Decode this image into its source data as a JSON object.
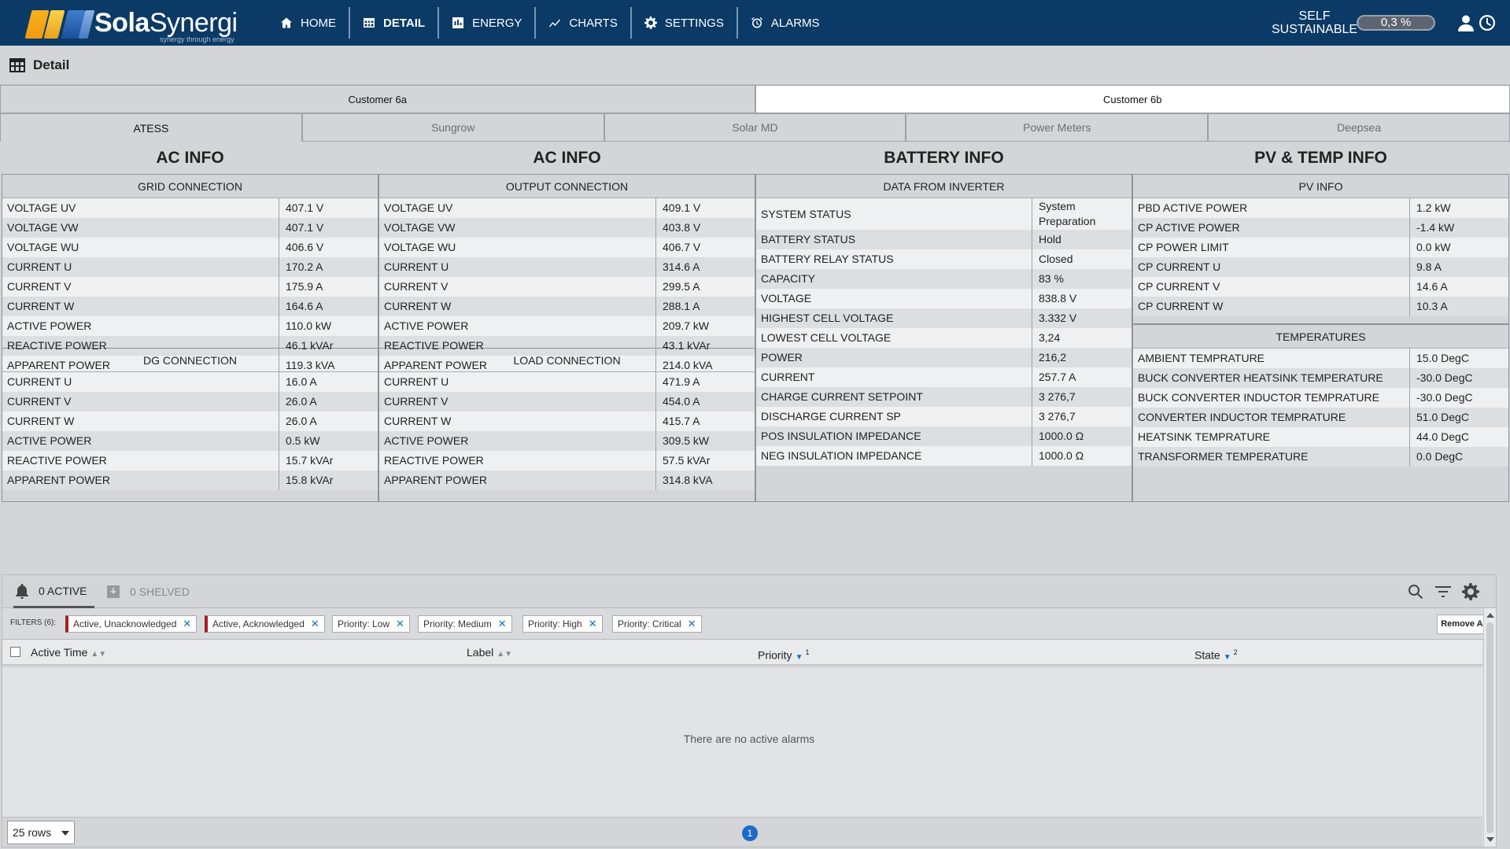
{
  "header": {
    "logo_text_bold": "Sola",
    "logo_text_light": "Synergi",
    "logo_tagline": "synergy through energy",
    "nav": [
      {
        "label": "HOME",
        "icon": "home-icon"
      },
      {
        "label": "DETAIL",
        "icon": "table-icon",
        "active": true
      },
      {
        "label": "ENERGY",
        "icon": "bar-chart-icon"
      },
      {
        "label": "CHARTS",
        "icon": "line-chart-icon"
      },
      {
        "label": "SETTINGS",
        "icon": "gear-icon"
      },
      {
        "label": "ALARMS",
        "icon": "alarm-clock-icon"
      }
    ],
    "self_sustainable_label_1": "SELF",
    "self_sustainable_label_2": "SUSTAINABLE",
    "self_sustainable_value": "0,3 %",
    "self_sustainable_fraction": 0.003
  },
  "breadcrumb": {
    "title": "Detail"
  },
  "customer_tabs": [
    {
      "label": "Customer 6a",
      "active": false
    },
    {
      "label": "Customer 6b",
      "active": true
    }
  ],
  "device_tabs": [
    {
      "label": "ATESS",
      "active": true
    },
    {
      "label": "Sungrow"
    },
    {
      "label": "Solar MD"
    },
    {
      "label": "Power Meters"
    },
    {
      "label": "Deepsea"
    }
  ],
  "columns": [
    {
      "title": "AC INFO"
    },
    {
      "title": "AC INFO"
    },
    {
      "title": "BATTERY INFO"
    },
    {
      "title": "PV & TEMP INFO"
    }
  ],
  "grid_connection": {
    "title": "GRID CONNECTION",
    "rows": [
      [
        "VOLTAGE UV",
        "407.1 V"
      ],
      [
        "VOLTAGE VW",
        "407.1 V"
      ],
      [
        "VOLTAGE WU",
        "406.6 V"
      ],
      [
        "CURRENT U",
        "170.2 A"
      ],
      [
        "CURRENT V",
        "175.9 A"
      ],
      [
        "CURRENT W",
        "164.6 A"
      ],
      [
        "ACTIVE POWER",
        "110.0 kW"
      ],
      [
        "REACTIVE POWER",
        "46.1 kVAr"
      ],
      [
        "APPARENT POWER",
        "119.3 kVA"
      ]
    ]
  },
  "dg_connection": {
    "title": "DG CONNECTION",
    "rows": [
      [
        "CURRENT U",
        "16.0 A"
      ],
      [
        "CURRENT V",
        "26.0 A"
      ],
      [
        "CURRENT W",
        "26.0 A"
      ],
      [
        "ACTIVE POWER",
        "0.5 kW"
      ],
      [
        "REACTIVE POWER",
        "15.7 kVAr"
      ],
      [
        "APPARENT POWER",
        "15.8 kVAr"
      ]
    ]
  },
  "output_connection": {
    "title": "OUTPUT CONNECTION",
    "rows": [
      [
        "VOLTAGE UV",
        "409.1 V"
      ],
      [
        "VOLTAGE VW",
        "403.8 V"
      ],
      [
        "VOLTAGE WU",
        "406.7 V"
      ],
      [
        "CURRENT U",
        "314.6 A"
      ],
      [
        "CURRENT V",
        "299.5 A"
      ],
      [
        "CURRENT W",
        "288.1 A"
      ],
      [
        "ACTIVE POWER",
        "209.7 kW"
      ],
      [
        "REACTIVE POWER",
        "43.1 kVAr"
      ],
      [
        "APPARENT POWER",
        "214.0 kVA"
      ]
    ]
  },
  "load_connection": {
    "title": "LOAD CONNECTION",
    "rows": [
      [
        "CURRENT U",
        "471.9 A"
      ],
      [
        "CURRENT V",
        "454.0 A"
      ],
      [
        "CURRENT W",
        "415.7 A"
      ],
      [
        "ACTIVE POWER",
        "309.5 kW"
      ],
      [
        "REACTIVE POWER",
        "57.5 kVAr"
      ],
      [
        "APPARENT POWER",
        "314.8 kVA"
      ]
    ]
  },
  "battery": {
    "title": "DATA FROM INVERTER",
    "rows": [
      [
        "SYSTEM STATUS",
        "System Preparation"
      ],
      [
        "BATTERY STATUS",
        "Hold"
      ],
      [
        "BATTERY RELAY STATUS",
        "Closed"
      ],
      [
        "CAPACITY",
        "83 %"
      ],
      [
        "VOLTAGE",
        "838.8 V"
      ],
      [
        "HIGHEST CELL VOLTAGE",
        "3.332 V"
      ],
      [
        "LOWEST CELL VOLTAGE",
        "3,24"
      ],
      [
        "POWER",
        "216,2"
      ],
      [
        "CURRENT",
        "257.7 A"
      ],
      [
        "CHARGE CURRENT SETPOINT",
        "3 276,7"
      ],
      [
        "DISCHARGE CURRENT SP",
        "3 276,7"
      ],
      [
        "POS INSULATION IMPEDANCE",
        "1000.0 Ω"
      ],
      [
        "NEG INSULATION IMPEDANCE",
        "1000.0 Ω"
      ]
    ]
  },
  "pv_info": {
    "title": "PV INFO",
    "rows": [
      [
        "PBD ACTIVE POWER",
        "1.2 kW"
      ],
      [
        "CP ACTIVE POWER",
        "-1.4 kW"
      ],
      [
        "CP POWER LIMIT",
        "0.0 kW"
      ],
      [
        "CP CURRENT U",
        "9.8 A"
      ],
      [
        "CP CURRENT V",
        "14.6 A"
      ],
      [
        "CP CURRENT W",
        "10.3 A"
      ]
    ]
  },
  "temperatures": {
    "title": "TEMPERATURES",
    "rows": [
      [
        "AMBIENT TEMPRATURE",
        "15.0 DegC"
      ],
      [
        "BUCK CONVERTER HEATSINK TEMPERATURE",
        "-30.0 DegC"
      ],
      [
        "BUCK CONVERTER INDUCTOR TEMPRATURE",
        "-30.0 DegC"
      ],
      [
        "CONVERTER INDUCTOR TEMPRATURE",
        "51.0 DegC"
      ],
      [
        "HEATSINK TEMPRATURE",
        "44.0 DegC"
      ],
      [
        "TRANSFORMER TEMPERATURE",
        "0.0 DegC"
      ]
    ]
  },
  "alarms": {
    "active_label": "0 ACTIVE",
    "shelved_label": "0 SHELVED",
    "filters_label": "FILTERS (6):",
    "filters": [
      {
        "label": "Active, Unacknowledged",
        "marker": true
      },
      {
        "label": "Active, Acknowledged",
        "marker": true
      },
      {
        "label": "Priority: Low"
      },
      {
        "label": "Priority: Medium"
      },
      {
        "label": "Priority: High"
      },
      {
        "label": "Priority: Critical"
      }
    ],
    "remove_all": "Remove All",
    "columns": [
      {
        "label": "Active Time",
        "sort_rank": ""
      },
      {
        "label": "Label",
        "sort_rank": ""
      },
      {
        "label": "Priority",
        "sort_rank": "1"
      },
      {
        "label": "State",
        "sort_rank": "2"
      }
    ],
    "empty_message": "There are no active alarms",
    "rows_per_page": "25 rows",
    "current_page": "1"
  }
}
